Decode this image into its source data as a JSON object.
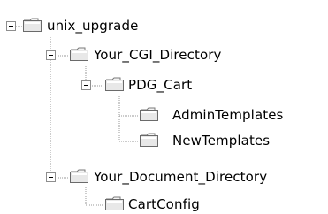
{
  "tree": {
    "nodes": [
      {
        "id": "root",
        "label": "unix_upgrade",
        "expanded": true,
        "icon": "folder-icon"
      },
      {
        "id": "cgi",
        "label": "Your_CGI_Directory",
        "expanded": true,
        "icon": "folder-icon"
      },
      {
        "id": "pdg",
        "label": "PDG_Cart",
        "expanded": true,
        "icon": "folder-icon"
      },
      {
        "id": "admin",
        "label": "AdminTemplates",
        "expanded": false,
        "icon": "folder-icon"
      },
      {
        "id": "new",
        "label": "NewTemplates",
        "expanded": false,
        "icon": "folder-icon"
      },
      {
        "id": "doc",
        "label": "Your_Document_Directory",
        "expanded": true,
        "icon": "folder-icon"
      },
      {
        "id": "cart",
        "label": "CartConfig",
        "expanded": false,
        "icon": "folder-icon"
      }
    ]
  }
}
